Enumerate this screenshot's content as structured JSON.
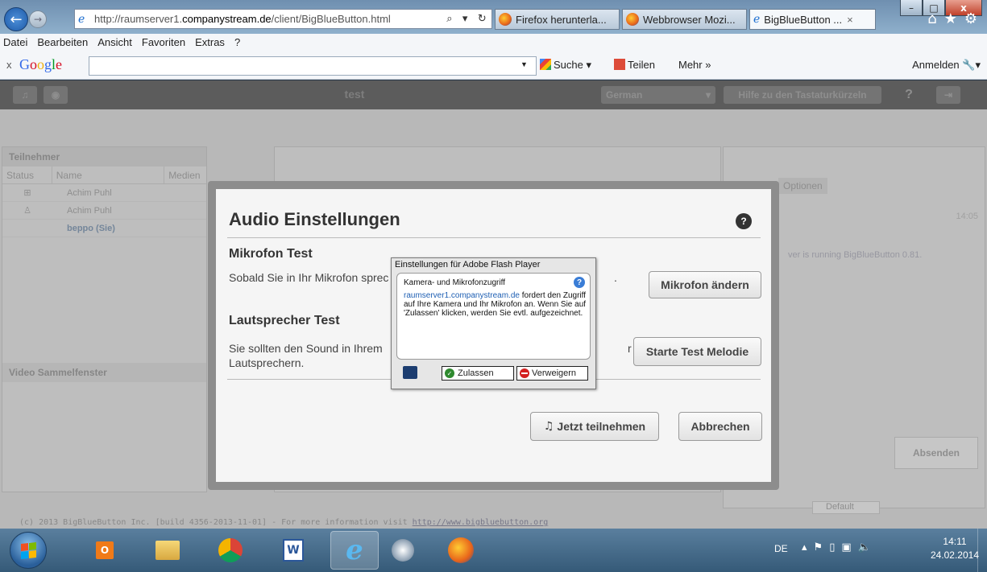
{
  "browser": {
    "url_prefix": "http://raumserver1.",
    "url_domain": "companystream.de",
    "url_path": "/client/BigBlueButton.html",
    "tabs": [
      {
        "label": "Firefox herunterla..."
      },
      {
        "label": "Webbrowser Mozi..."
      },
      {
        "label": "BigBlueButton ..."
      }
    ],
    "window_controls": {
      "minimize": "–",
      "maximize": "□",
      "close": "x"
    }
  },
  "menubar": [
    "Datei",
    "Bearbeiten",
    "Ansicht",
    "Favoriten",
    "Extras",
    "?"
  ],
  "googlebar": {
    "close": "x",
    "logo": "Google",
    "search_value": "",
    "suche": "Suche",
    "teilen": "Teilen",
    "mehr": "Mehr »",
    "anmelden": "Anmelden"
  },
  "bbb": {
    "title": "test",
    "language": "German",
    "shortcut_help": "Hilfe zu den Tastaturkürzeln",
    "help": "?",
    "participants": {
      "title": "Teilnehmer",
      "columns": [
        "Status",
        "Name",
        "Medien"
      ],
      "users": [
        {
          "name": "Achim Puhl"
        },
        {
          "name": "Achim Puhl"
        },
        {
          "name": "beppo (Sie)"
        }
      ]
    },
    "video_window": "Video Sammelfenster",
    "chat": {
      "options_tab": "Optionen",
      "time": "14:05",
      "message": "ver is running BigBlueButton 0.81.",
      "send": "Absenden",
      "font": "Default"
    },
    "footer": "(c) 2013 BigBlueButton Inc. [build 4356-2013-11-01] - For more information visit",
    "footer_link": "http://www.bigbluebutton.org"
  },
  "dialog": {
    "title": "Audio Einstellungen",
    "help": "?",
    "mic_heading": "Mikrofon Test",
    "mic_text_left": "Sobald Sie in Ihr Mikrofon sprec",
    "mic_text_right": ".",
    "mic_button": "Mikrofon ändern",
    "speaker_heading": "Lautsprecher Test",
    "speaker_text_left": "Sie sollten den Sound in Ihrem",
    "speaker_text_line2": "Lautsprechern.",
    "speaker_text_right": "r",
    "speaker_button": "Starte Test Melodie",
    "join_button": "Jetzt teilnehmen",
    "cancel_button": "Abbrechen"
  },
  "flash": {
    "title": "Einstellungen für Adobe Flash Player",
    "heading": "Kamera- und Mikrofonzugriff",
    "domain": "raumserver1.companystream.de",
    "body": " fordert den Zugriff auf Ihre Kamera und Ihr Mikrofon an. Wenn Sie auf 'Zulassen' klicken, werden Sie evtl. aufgezeichnet.",
    "allow": "Zulassen",
    "deny": "Verweigern"
  },
  "taskbar": {
    "lang": "DE",
    "time": "14:11",
    "date": "24.02.2014"
  },
  "colors": {
    "bbb_topbar": "#3f3f3f",
    "dialog_frame": "#8d8d8d",
    "link_blue": "#1e5fb3"
  }
}
